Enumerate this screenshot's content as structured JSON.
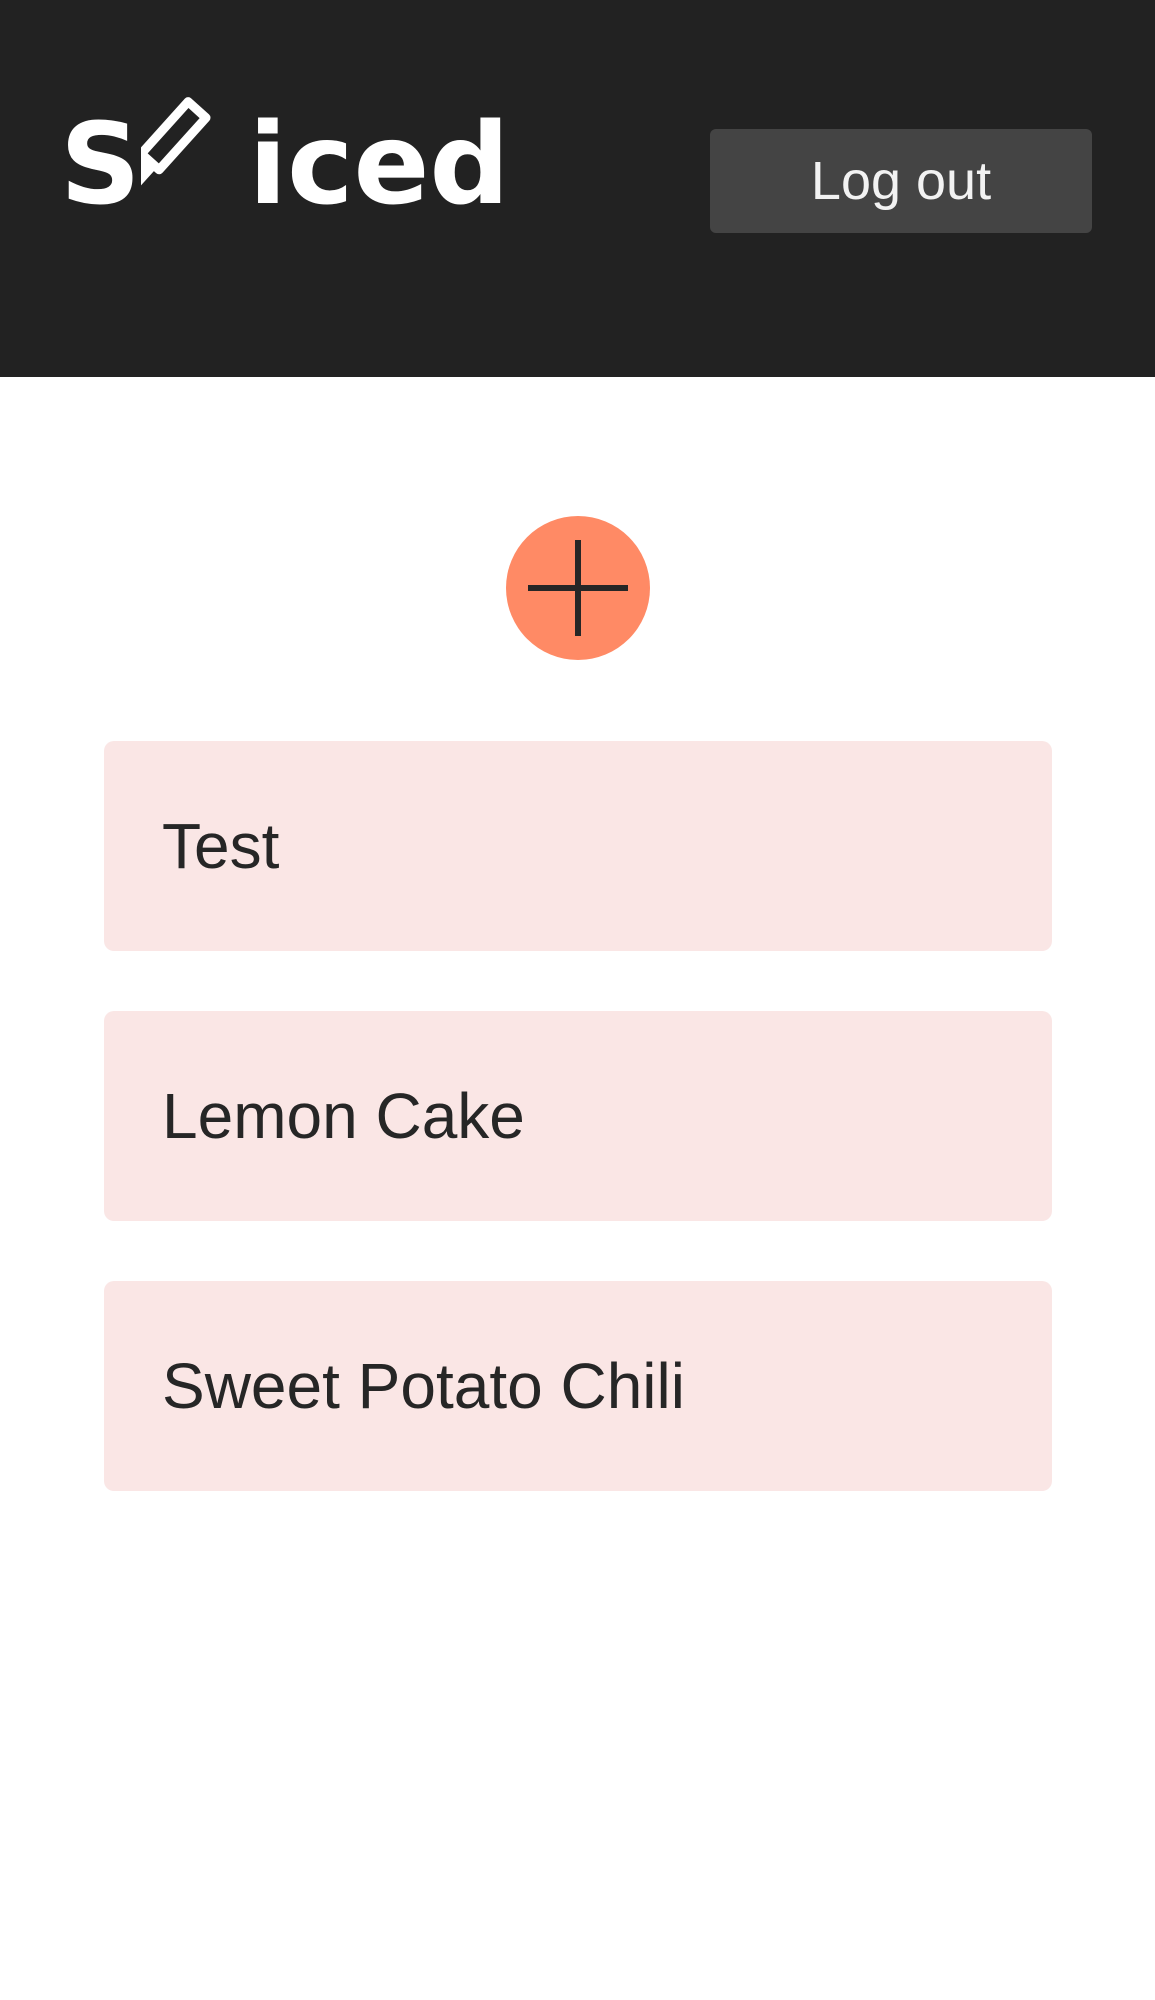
{
  "header": {
    "logo": {
      "prefix": "S",
      "suffix": "iced",
      "icon": "knife-icon"
    },
    "logout_label": "Log out"
  },
  "add_button": {
    "icon": "plus-icon",
    "color": "#ff8a65"
  },
  "recipes": [
    {
      "name": "Test"
    },
    {
      "name": "Lemon Cake"
    },
    {
      "name": "Sweet Potato Chili"
    }
  ],
  "colors": {
    "header_bg": "#222222",
    "button_bg": "#444444",
    "card_bg": "#fae6e5",
    "accent": "#ff8a65"
  }
}
